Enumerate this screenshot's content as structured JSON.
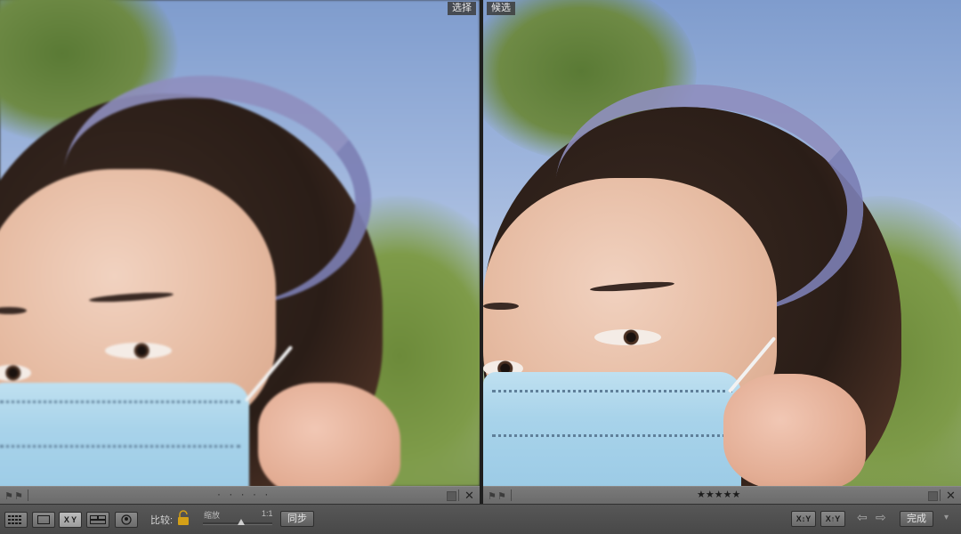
{
  "compare": {
    "left_label": "选择",
    "right_label": "候选"
  },
  "left_bar": {
    "dots": "· · · · ·",
    "close": "✕"
  },
  "right_bar": {
    "rating": 5,
    "stars": "★★★★★",
    "close": "✕"
  },
  "toolbar": {
    "compare_label": "比较:",
    "zoom_label": "缩放",
    "zoom_ratio": "1:1",
    "zoom_level": 0.55,
    "sync_button": "同步",
    "xy_label": "X Y",
    "done_button": "完成",
    "swap_label": "X↕Y",
    "make_select_label": "X↑Y"
  },
  "colors": {
    "toolbar_bg": "#4f4f4f",
    "infobar_bg": "#727272",
    "mask_blue": "#a8d3ea"
  }
}
